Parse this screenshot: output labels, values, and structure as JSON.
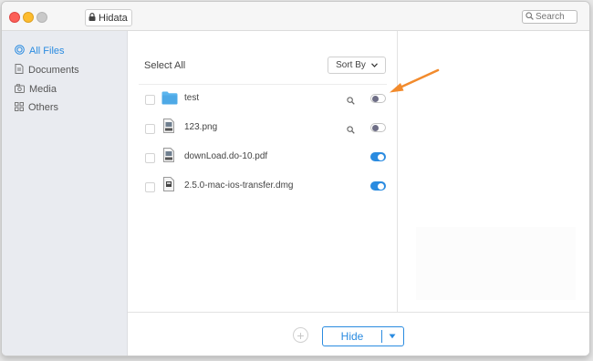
{
  "app": {
    "title": "Hidata"
  },
  "search": {
    "placeholder": "Search"
  },
  "sidebar": {
    "items": [
      {
        "label": "All Files",
        "icon": "target-icon",
        "active": true
      },
      {
        "label": "Documents",
        "icon": "document-icon",
        "active": false
      },
      {
        "label": "Media",
        "icon": "media-icon",
        "active": false
      },
      {
        "label": "Others",
        "icon": "grid-icon",
        "active": false
      }
    ]
  },
  "main": {
    "select_all_label": "Select All",
    "sort_by_label": "Sort By",
    "files": [
      {
        "name": "test",
        "icon": "folder-icon",
        "hidden": false,
        "searchable": true
      },
      {
        "name": "123.png",
        "icon": "png-file-icon",
        "hidden": false,
        "searchable": true
      },
      {
        "name": "downLoad.do-10.pdf",
        "icon": "pdf-file-icon",
        "hidden": true,
        "searchable": false
      },
      {
        "name": "2.5.0-mac-ios-transfer.dmg",
        "icon": "dmg-file-icon",
        "hidden": true,
        "searchable": false
      }
    ]
  },
  "bottom": {
    "hide_label": "Hide"
  },
  "colors": {
    "accent": "#2a8be0",
    "arrow": "#f28b2d",
    "sidebar_bg": "#e9ebf0"
  }
}
